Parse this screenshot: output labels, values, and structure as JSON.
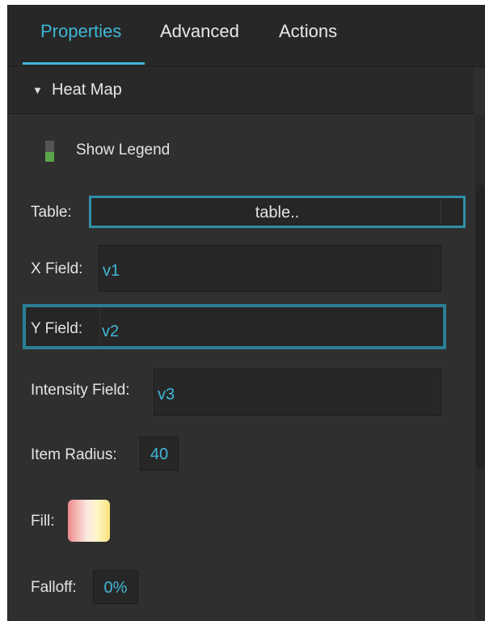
{
  "tabs": [
    {
      "label": "Properties",
      "active": true
    },
    {
      "label": "Advanced",
      "active": false
    },
    {
      "label": "Actions",
      "active": false
    }
  ],
  "section": {
    "arrow": "▼",
    "title": "Heat Map"
  },
  "show_legend": {
    "label": "Show Legend",
    "checked": true
  },
  "table": {
    "label": "Table:",
    "value": "table.."
  },
  "x_field": {
    "label": "X Field:",
    "value": "v1"
  },
  "y_field": {
    "label": "Y Field:",
    "value": "v2"
  },
  "intensity_field": {
    "label": "Intensity Field:",
    "value": "v3"
  },
  "item_radius": {
    "label": "Item Radius:",
    "value": "40"
  },
  "fill": {
    "label": "Fill:"
  },
  "falloff": {
    "label": "Falloff:",
    "value": "0%"
  },
  "colors": {
    "accent": "#3fb7d6",
    "panel": "#2f2f2f",
    "toggle_on": "#59a64a"
  }
}
